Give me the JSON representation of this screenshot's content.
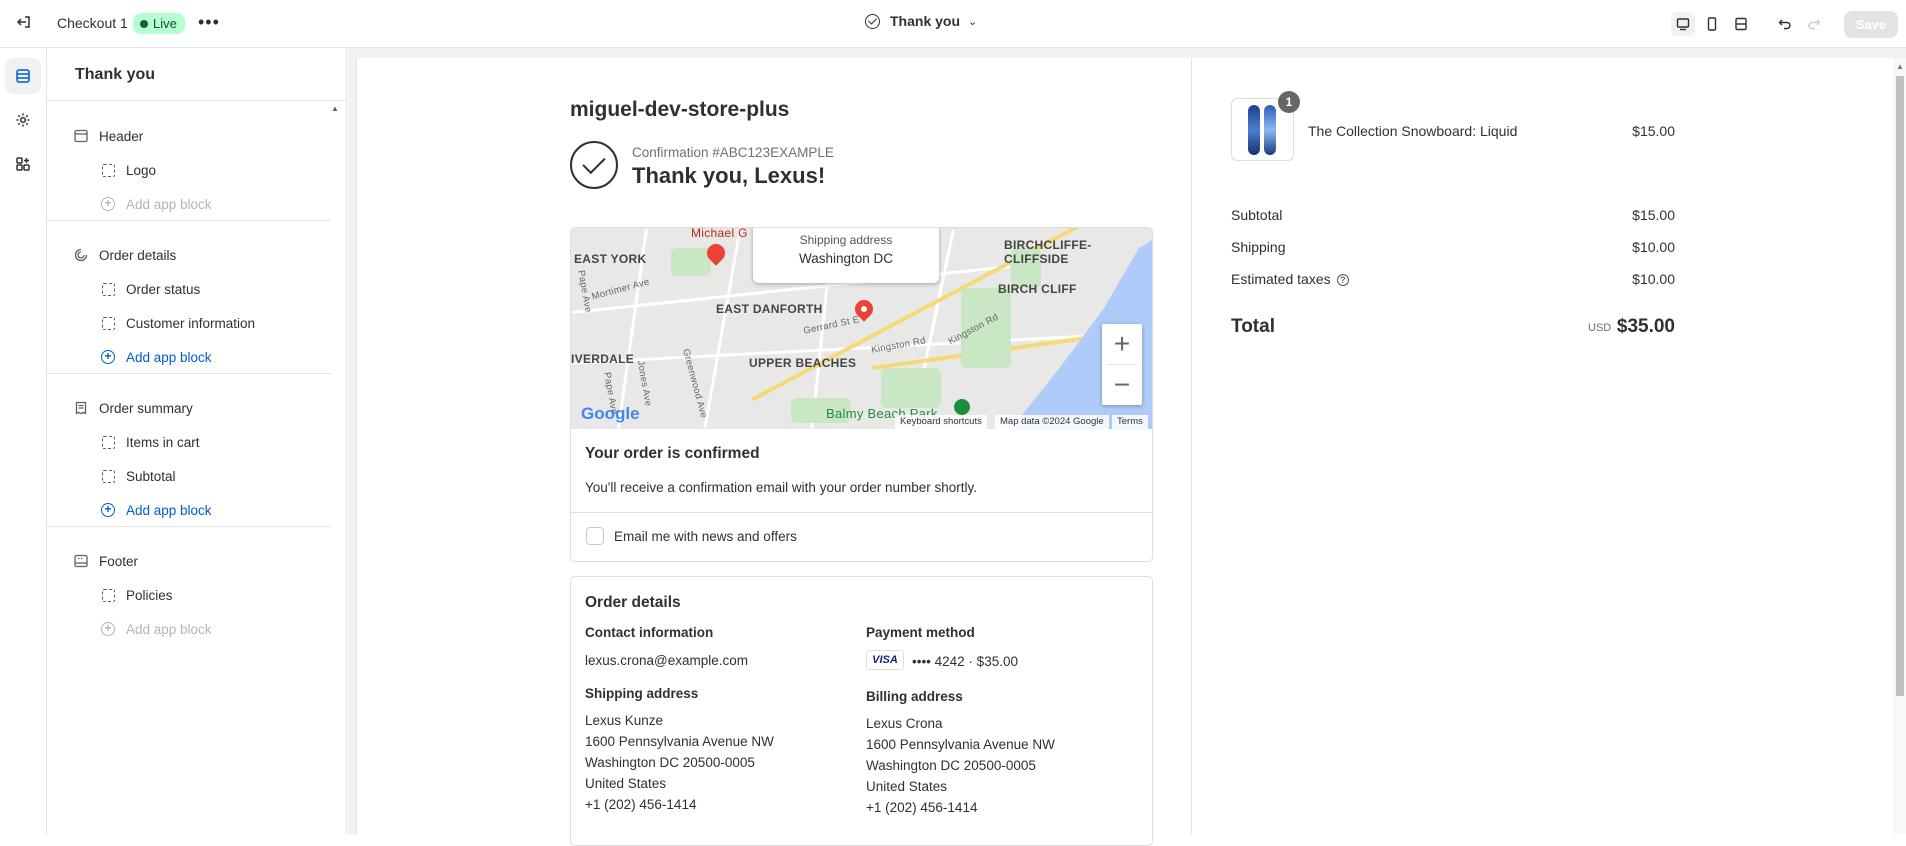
{
  "topbar": {
    "title": "Checkout 1",
    "live_badge": "Live",
    "page_selector": "Thank you",
    "save_label": "Save"
  },
  "sidebar": {
    "title": "Thank you",
    "sections": [
      {
        "label": "Header",
        "items": [
          "Logo"
        ],
        "add_label": "Add app block",
        "add_enabled": false
      },
      {
        "label": "Order details",
        "items": [
          "Order status",
          "Customer information"
        ],
        "add_label": "Add app block",
        "add_enabled": true
      },
      {
        "label": "Order summary",
        "items": [
          "Items in cart",
          "Subtotal"
        ],
        "add_label": "Add app block",
        "add_enabled": true
      },
      {
        "label": "Footer",
        "items": [
          "Policies"
        ],
        "add_label": "Add app block",
        "add_enabled": false
      }
    ]
  },
  "preview": {
    "store_name": "miguel-dev-store-plus",
    "confirmation": "Confirmation #ABC123EXAMPLE",
    "thanks": "Thank you, Lexus!",
    "map": {
      "popup_label": "Shipping address",
      "popup_value": "Washington DC",
      "labels": {
        "east_york": "EAST YORK",
        "birchcliffe": "BIRCHCLIFFE-CLIFFSIDE",
        "birch_cliff": "BIRCH CLIFF",
        "east_danforth": "EAST DANFORTH",
        "riverdale": "IVERDALE",
        "upper_beaches": "UPPER BEACHES",
        "balmy": "Balmy Beach Park",
        "michael": "Michael G",
        "mortimer": "Mortimer Ave",
        "gerrard": "Gerrard St E",
        "kingston1": "Kingston Rd",
        "kingston2": "Kingston Rd",
        "pape": "Pape Ave",
        "pape2": "Pape Ave",
        "jones": "Jones Ave",
        "greenwood": "Greenwood Ave"
      },
      "google": "Google",
      "attr_shortcuts": "Keyboard shortcuts",
      "attr_data": "Map data ©2024 Google",
      "attr_terms": "Terms"
    },
    "confirmed_title": "Your order is confirmed",
    "confirmed_text": "You'll receive a confirmation email with your order number shortly.",
    "email_opt": "Email me with news and offers",
    "order_details": {
      "title": "Order details",
      "contact_h": "Contact information",
      "contact": "lexus.crona@example.com",
      "payment_h": "Payment method",
      "card_brand": "VISA",
      "payment": "•••• 4242 · $35.00",
      "shipping_h": "Shipping address",
      "shipping": [
        "Lexus Kunze",
        "1600 Pennsylvania Avenue NW",
        "Washington DC 20500-0005",
        "United States",
        "+1 (202) 456-1414"
      ],
      "billing_h": "Billing address",
      "billing": [
        "Lexus Crona",
        "1600 Pennsylvania Avenue NW",
        "Washington DC 20500-0005",
        "United States",
        "+1 (202) 456-1414"
      ]
    }
  },
  "summary": {
    "item_qty": "1",
    "item_name": "The Collection Snowboard: Liquid",
    "item_price": "$15.00",
    "subtotal_label": "Subtotal",
    "subtotal": "$15.00",
    "shipping_label": "Shipping",
    "shipping": "$10.00",
    "taxes_label": "Estimated taxes",
    "taxes": "$10.00",
    "total_label": "Total",
    "currency": "USD",
    "total": "$35.00"
  },
  "colors": {
    "accent": "#005bd3",
    "live_badge_bg": "#b4fed2",
    "map_water": "#aecbfa",
    "pin": "#ea4335"
  }
}
